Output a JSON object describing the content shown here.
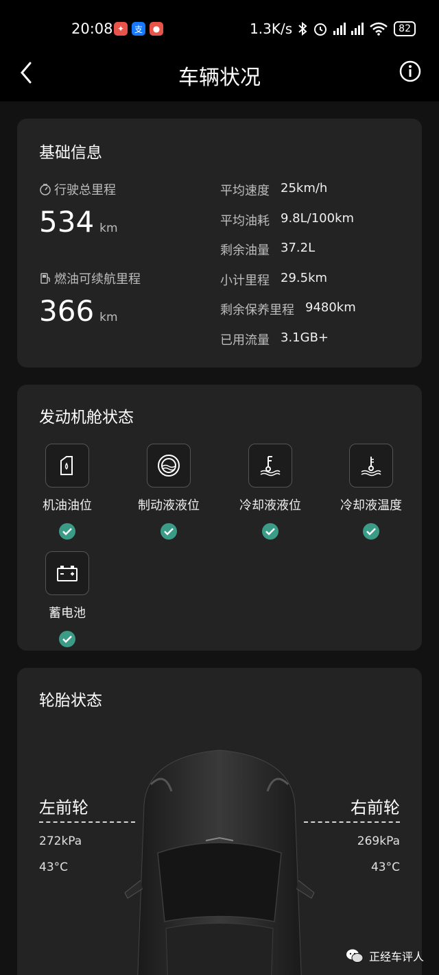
{
  "status_bar": {
    "time": "20:08",
    "network_speed": "1.3K/s",
    "battery": "82"
  },
  "header": {
    "title": "车辆状况",
    "back_icon": "chevron-left-icon",
    "info_icon": "info-icon"
  },
  "basic_info": {
    "title": "基础信息",
    "total_mileage_label": "行驶总里程",
    "total_mileage_value": "534",
    "total_mileage_unit": "km",
    "range_label": "燃油可续航里程",
    "range_value": "366",
    "range_unit": "km",
    "rows": [
      {
        "label": "平均速度",
        "value": "25km/h"
      },
      {
        "label": "平均油耗",
        "value": "9.8L/100km"
      },
      {
        "label": "剩余油量",
        "value": "37.2L"
      },
      {
        "label": "小计里程",
        "value": "29.5km"
      },
      {
        "label": "剩余保养里程",
        "value": "9480km"
      },
      {
        "label": "已用流量",
        "value": "3.1GB+"
      }
    ]
  },
  "engine": {
    "title": "发动机舱状态",
    "items": [
      {
        "label": "机油油位",
        "icon": "oil-can-icon",
        "status": "ok"
      },
      {
        "label": "制动液液位",
        "icon": "brake-fluid-icon",
        "status": "ok"
      },
      {
        "label": "冷却液液位",
        "icon": "coolant-level-icon",
        "status": "ok"
      },
      {
        "label": "冷却液温度",
        "icon": "coolant-temp-icon",
        "status": "ok"
      },
      {
        "label": "蓄电池",
        "icon": "battery-icon",
        "status": "ok"
      }
    ],
    "status_color": "#3a9c86"
  },
  "tires": {
    "title": "轮胎状态",
    "front_left": {
      "name": "左前轮",
      "pressure": "272kPa",
      "temp": "43°C"
    },
    "front_right": {
      "name": "右前轮",
      "pressure": "269kPa",
      "temp": "43°C"
    }
  },
  "watermark": {
    "text": "正经车评人"
  }
}
